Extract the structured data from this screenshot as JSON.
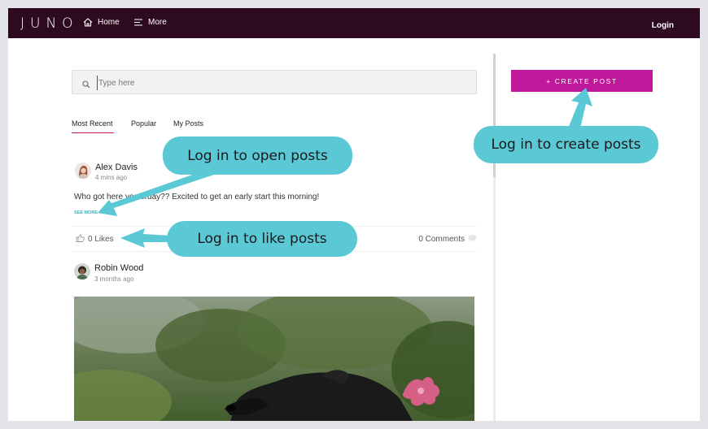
{
  "nav": {
    "logo": "JUNO",
    "home_label": "Home",
    "more_label": "More",
    "login_label": "Login",
    "bg_color": "#2d0a1f"
  },
  "search": {
    "placeholder": "Type here",
    "icon": "search-icon"
  },
  "tabs": [
    {
      "label": "Most Recent",
      "active": true
    },
    {
      "label": "Popular",
      "active": false
    },
    {
      "label": "My Posts",
      "active": false
    }
  ],
  "posts": [
    {
      "author": "Alex Davis",
      "time": "4 mins ago",
      "text": "Who got here yesterday?? Excited to get an early start this morning!",
      "see_more": "SEE MORE",
      "likes": "0 Likes",
      "comments": "0 Comments"
    },
    {
      "author": "Robin Wood",
      "time": "3 months ago"
    }
  ],
  "create_post": {
    "label": "+ CREATE POST",
    "color": "#c0189a"
  },
  "callouts": {
    "open": "Log in to open posts",
    "like": "Log in to like posts",
    "create": "Log in to create posts",
    "color": "#5bc8d6"
  }
}
